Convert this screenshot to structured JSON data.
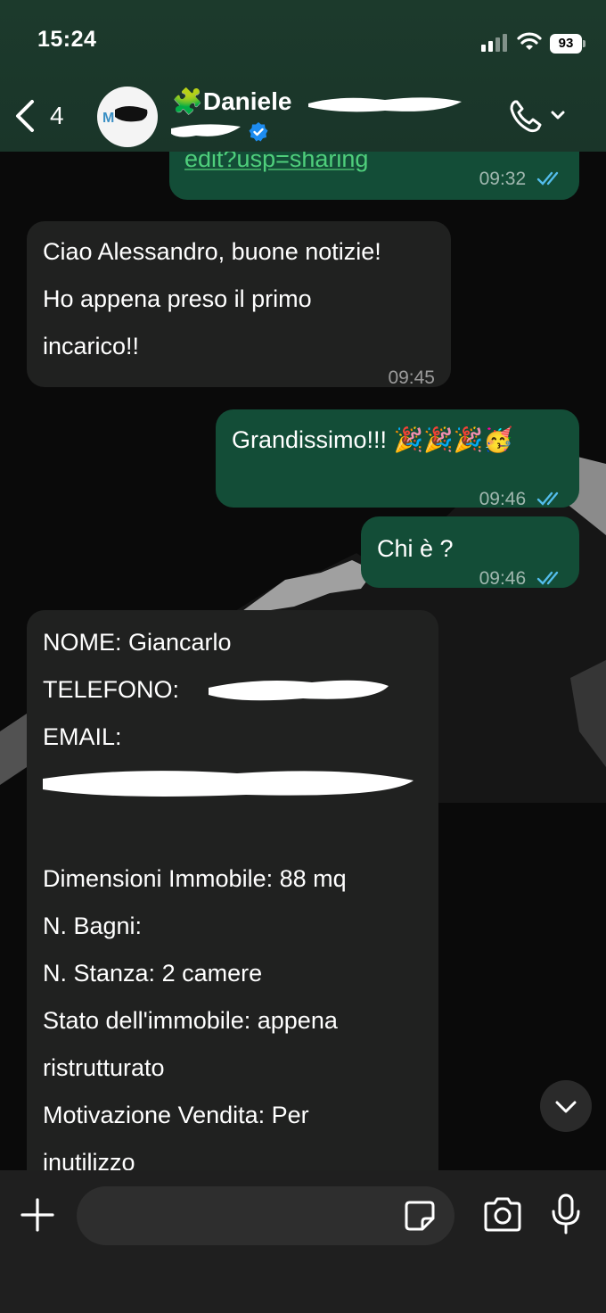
{
  "status_bar": {
    "time": "15:24",
    "battery": "93"
  },
  "header": {
    "back_count": "4",
    "contact_name": "🧩Daniele",
    "avatar_text": "M"
  },
  "messages": [
    {
      "direction": "out",
      "text": "edit?usp=sharing",
      "time": "09:32",
      "ticks": "read"
    },
    {
      "direction": "in",
      "lines": [
        "Ciao Alessandro, buone notizie!",
        "Ho appena preso il primo",
        "incarico!!"
      ],
      "time": "09:45"
    },
    {
      "direction": "out",
      "text": "Grandissimo!!! 🎉🎉🎉🥳",
      "time": "09:46",
      "ticks": "read"
    },
    {
      "direction": "out",
      "text": "Chi è ?",
      "time": "09:46",
      "ticks": "read"
    },
    {
      "direction": "in",
      "lines": [
        "NOME: Giancarlo",
        "TELEFONO:",
        "EMAIL:",
        "",
        "",
        "Dimensioni Immobile: 88 mq",
        "N. Bagni:",
        "N. Stanza: 2 camere",
        "Stato dell'immobile: appena",
        "ristrutturato",
        "Motivazione Vendita: Per",
        "inutilizzo"
      ]
    }
  ],
  "composer": {
    "placeholder": ""
  },
  "colors": {
    "outgoing_bubble": "#134d37",
    "incoming_bubble": "#202120",
    "link": "#4fcf7c",
    "tick": "#53bdeb"
  }
}
